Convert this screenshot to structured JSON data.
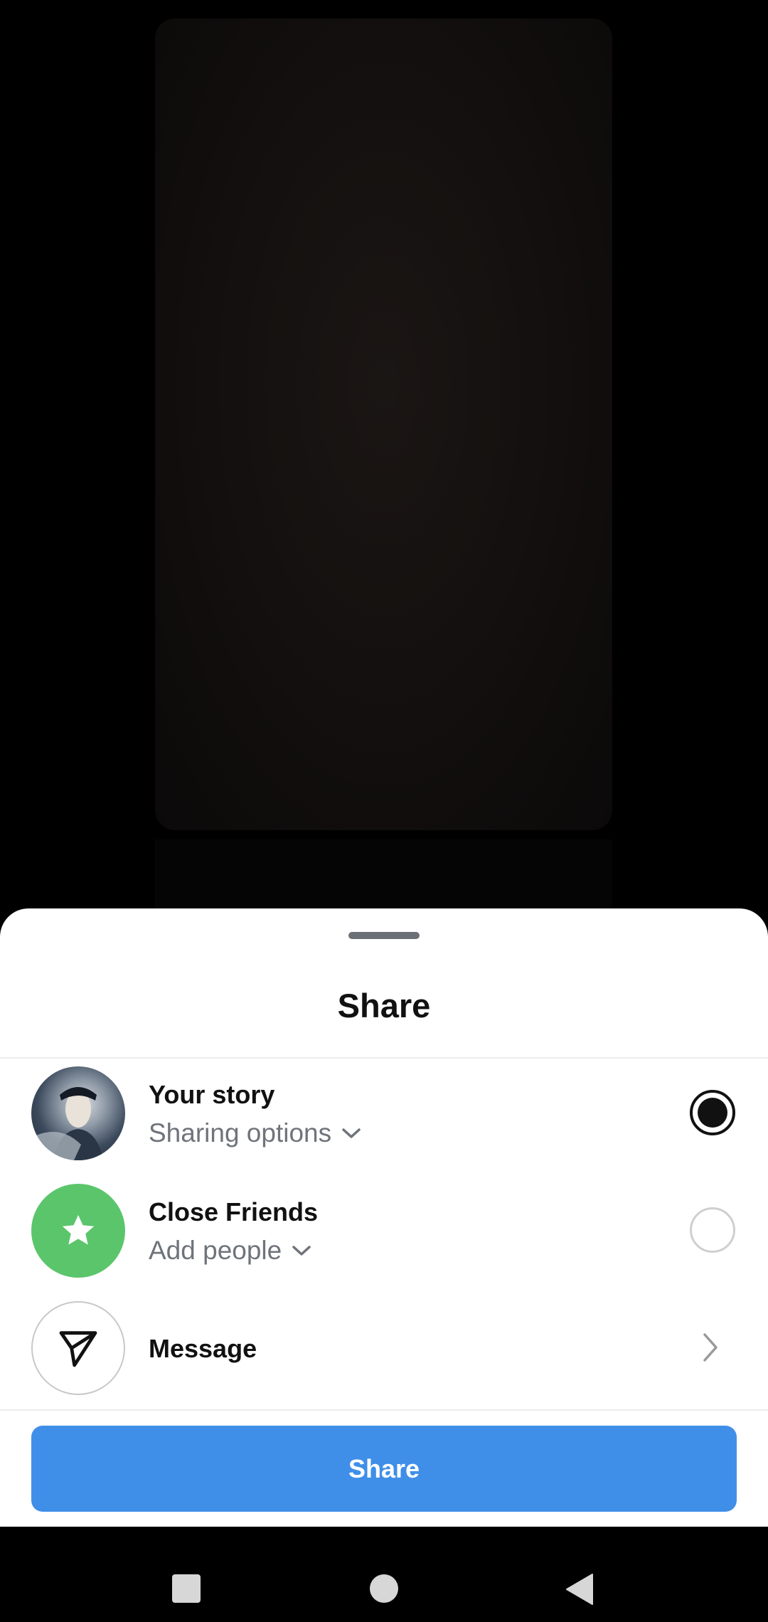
{
  "sheet": {
    "title": "Share",
    "options": [
      {
        "title": "Your story",
        "subtitle": "Sharing options",
        "selected": true,
        "icon": "profile-avatar"
      },
      {
        "title": "Close Friends",
        "subtitle": "Add people",
        "selected": false,
        "icon": "star-icon",
        "icon_bg": "#5bc56b"
      },
      {
        "title": "Message",
        "icon": "send-icon",
        "trailing": "chevron-right-icon"
      }
    ],
    "share_button": {
      "label": "Share",
      "color": "#3f8fe9"
    }
  },
  "navbar": {
    "buttons": [
      "recents-icon",
      "home-icon",
      "back-icon"
    ]
  }
}
